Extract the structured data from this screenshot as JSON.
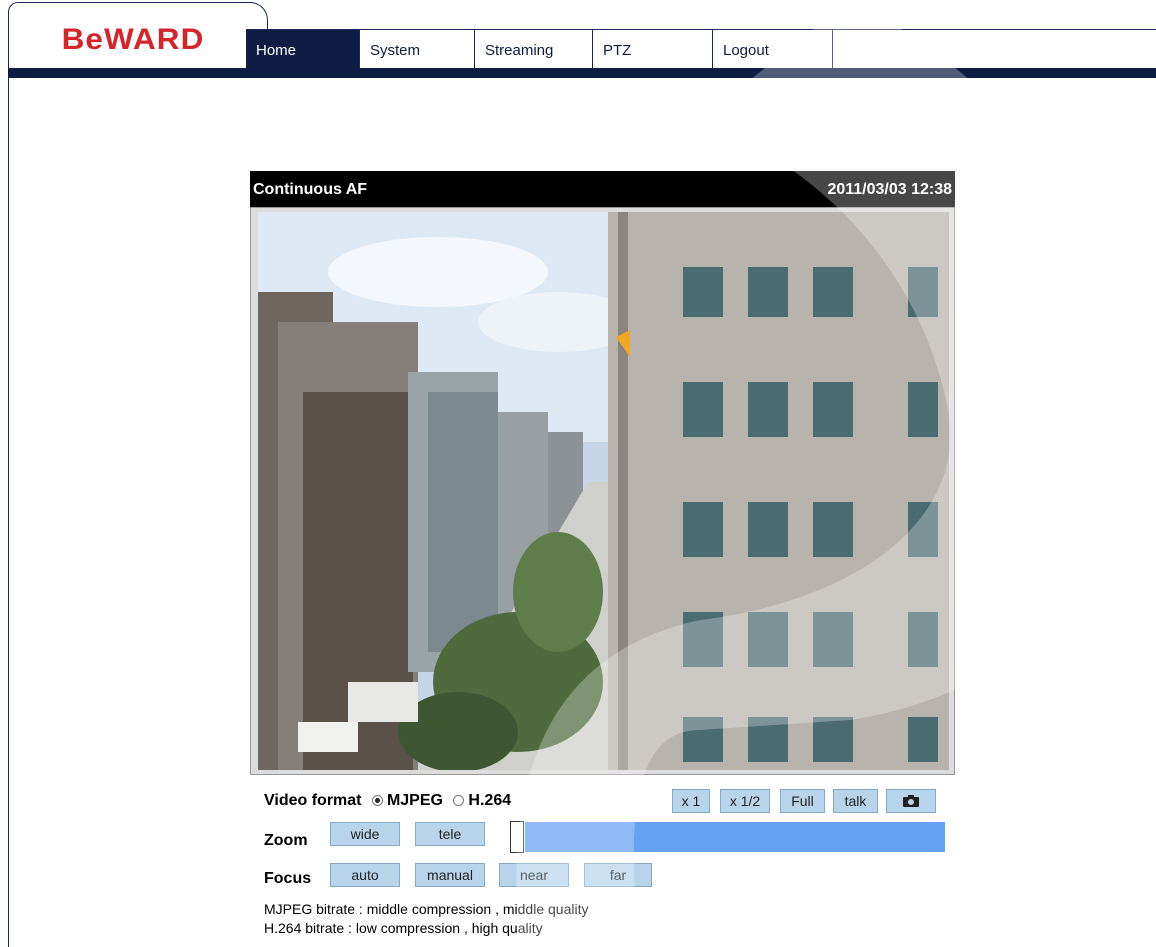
{
  "brand": {
    "logo_text": "BeWARD",
    "color": "#d5252b"
  },
  "nav": {
    "items": [
      {
        "label": "Home",
        "active": true
      },
      {
        "label": "System",
        "active": false
      },
      {
        "label": "Streaming",
        "active": false
      },
      {
        "label": "PTZ",
        "active": false
      },
      {
        "label": "Logout",
        "active": false
      }
    ]
  },
  "video": {
    "title": "Continuous AF",
    "datetime": "2011/03/03 12:38"
  },
  "format": {
    "label": "Video format",
    "options": [
      {
        "label": "MJPEG",
        "selected": true
      },
      {
        "label": "H.264",
        "selected": false
      }
    ]
  },
  "view_buttons": [
    "x 1",
    "x 1/2",
    "Full",
    "talk",
    "camera-icon"
  ],
  "zoom": {
    "label": "Zoom",
    "wide": "wide",
    "tele": "tele",
    "level": 0.0
  },
  "focus": {
    "label": "Focus",
    "auto": "auto",
    "manual": "manual",
    "near": "near",
    "far": "far"
  },
  "bitrate": {
    "mjpeg": "MJPEG bitrate : middle compression , middle quality",
    "h264": "H.264 bitrate : low compression , high quality"
  },
  "colors": {
    "nav_dark": "#0f1c44",
    "button": "#b8d4ea",
    "zoom_track": "#66a0f2"
  }
}
